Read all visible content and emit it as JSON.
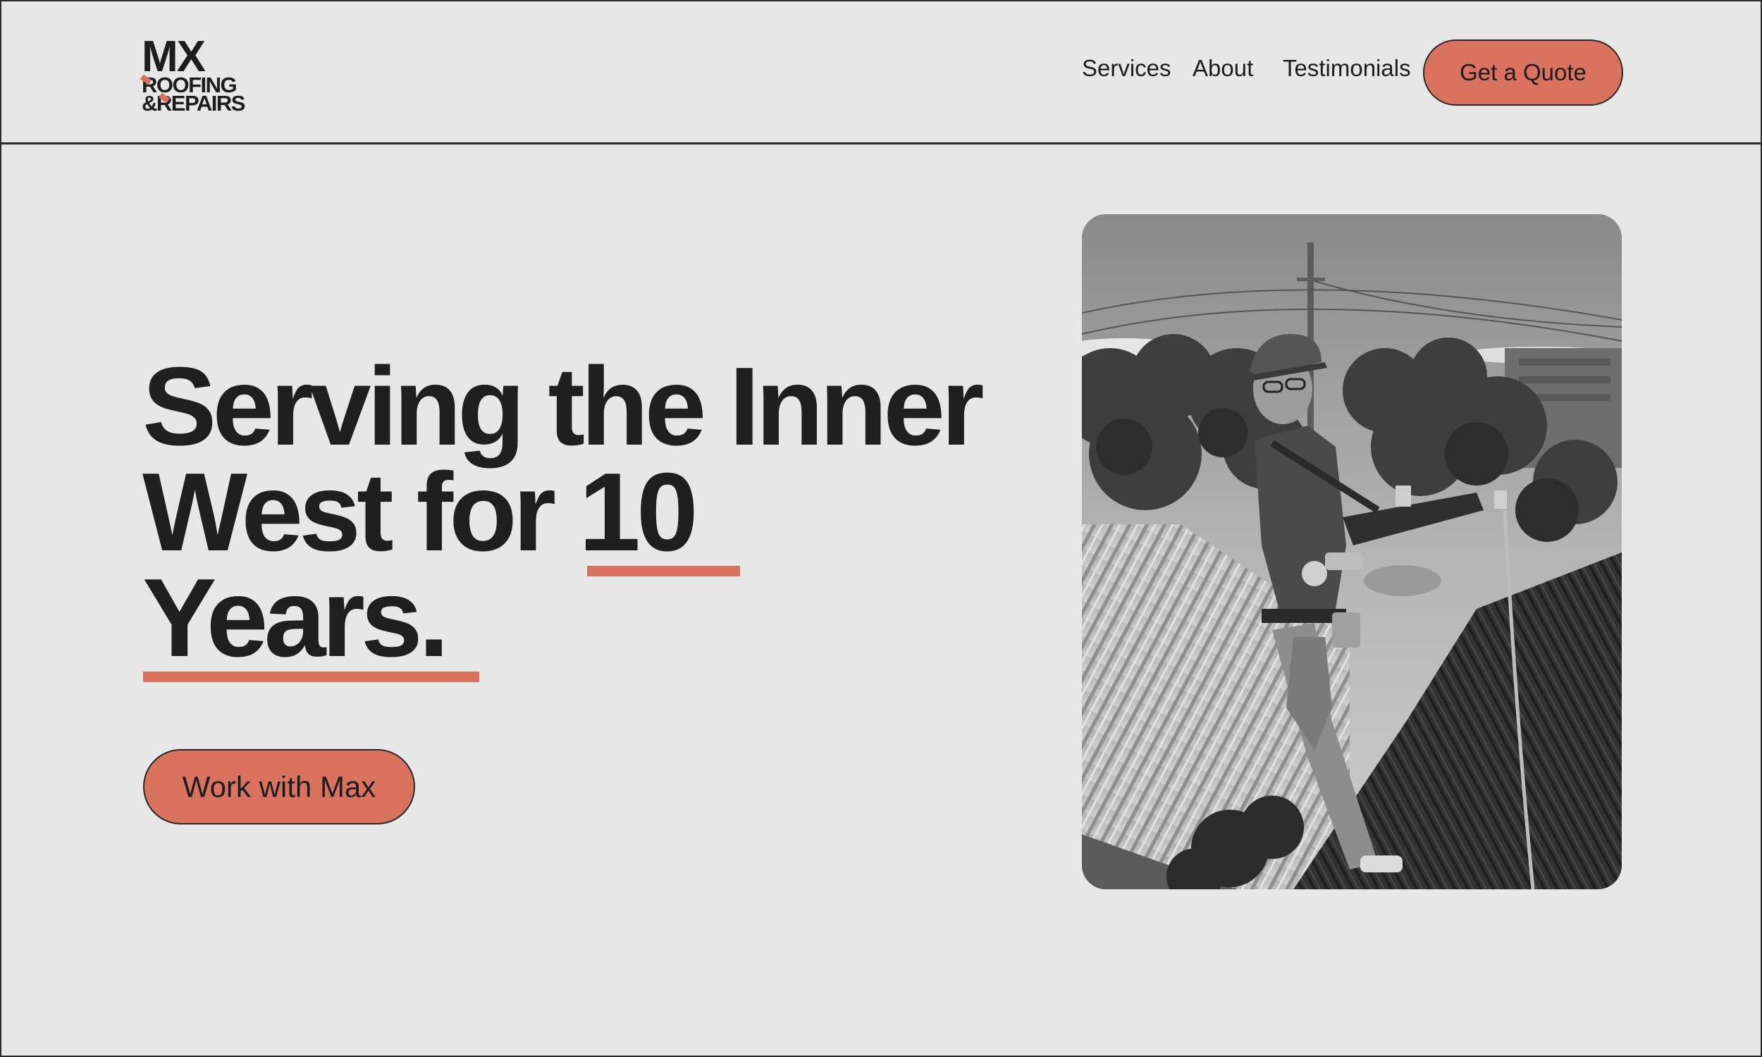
{
  "brand": {
    "logo_line1": "MX",
    "logo_line2": "ROOFING",
    "logo_line3": "&REPAIRS",
    "accent_color": "#d9725e"
  },
  "nav": {
    "items": [
      {
        "label": "Services"
      },
      {
        "label": "About"
      },
      {
        "label": "Testimonials"
      }
    ],
    "cta_label": "Get a Quote"
  },
  "hero": {
    "headline_line1": "Serving the Inner",
    "headline_line2_prefix": "West for ",
    "headline_highlight": "10",
    "headline_line3": "Years.",
    "cta_label": "Work with Max"
  },
  "colors": {
    "background": "#e8e7e7",
    "text": "#1f1f1f",
    "accent": "#d9725e"
  }
}
